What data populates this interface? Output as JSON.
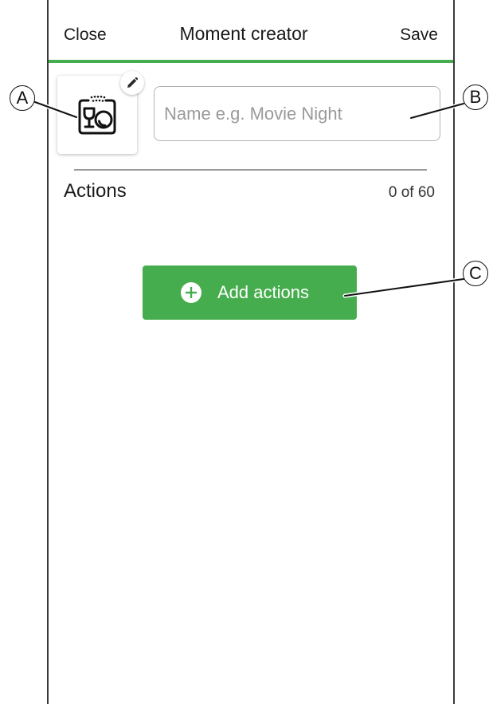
{
  "header": {
    "close_label": "Close",
    "title": "Moment creator",
    "save_label": "Save"
  },
  "moment": {
    "icon": "wine-glass-plate-icon",
    "edit_icon": "pencil-icon"
  },
  "name_input": {
    "placeholder": "Name e.g. Movie Night",
    "value": ""
  },
  "actions": {
    "label": "Actions",
    "count": "0 of 60"
  },
  "add_button": {
    "label": "Add actions",
    "icon": "plus-circle-icon"
  },
  "callouts": {
    "a": "A",
    "b": "B",
    "c": "C"
  },
  "colors": {
    "accent": "#45ad4d",
    "frame": "#3a3a3a",
    "input_border": "#b3b3b3",
    "placeholder": "#9a9a9a"
  }
}
